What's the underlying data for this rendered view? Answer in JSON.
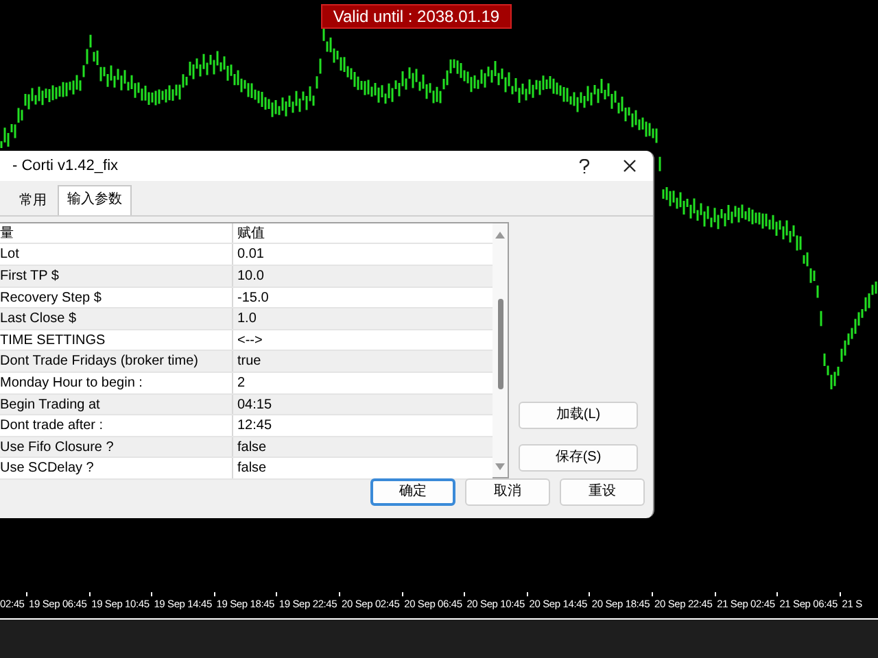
{
  "chart": {
    "badge": "Valid until : 2038.01.19",
    "time_axis": [
      "02:45",
      "19 Sep 06:45",
      "19 Sep 10:45",
      "19 Sep 14:45",
      "19 Sep 18:45",
      "19 Sep 22:45",
      "20 Sep 02:45",
      "20 Sep 06:45",
      "20 Sep 10:45",
      "20 Sep 14:45",
      "20 Sep 18:45",
      "20 Sep 22:45",
      "21 Sep 02:45",
      "21 Sep 06:45",
      "21 S"
    ]
  },
  "dialog": {
    "title": "- Corti v1.42_fix",
    "tabs": [
      {
        "label": "常用",
        "selected": false
      },
      {
        "label": "输入参数",
        "selected": true
      }
    ],
    "table": {
      "columns": [
        "量",
        "赋值"
      ],
      "rows": [
        {
          "name": "Lot",
          "value": "0.01"
        },
        {
          "name": "First TP $",
          "value": "10.0"
        },
        {
          "name": "Recovery Step $",
          "value": "-15.0"
        },
        {
          "name": "Last Close $",
          "value": "1.0"
        },
        {
          "name": "TIME SETTINGS",
          "value": "<-->"
        },
        {
          "name": "Dont Trade Fridays (broker time)",
          "value": "true"
        },
        {
          "name": "Monday Hour to begin :",
          "value": "2"
        },
        {
          "name": "Begin Trading at",
          "value": "04:15"
        },
        {
          "name": "Dont trade after :",
          "value": "12:45"
        },
        {
          "name": "Use Fifo Closure ?",
          "value": "false"
        },
        {
          "name": "Use SCDelay ?",
          "value": "false"
        }
      ]
    },
    "side_buttons": [
      "加载(L)",
      "保存(S)"
    ],
    "buttons": [
      {
        "label": "确定",
        "default": true
      },
      {
        "label": "取消",
        "default": false
      },
      {
        "label": "重设",
        "default": false
      }
    ]
  }
}
